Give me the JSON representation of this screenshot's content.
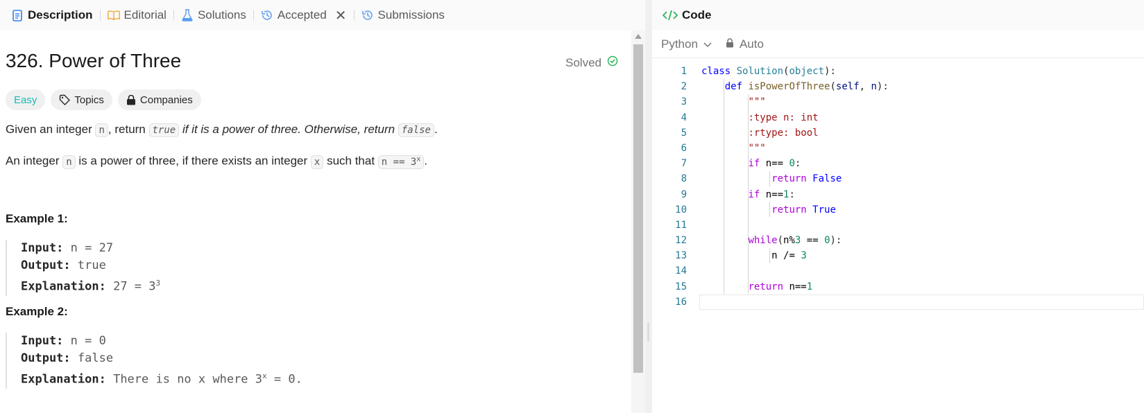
{
  "tabs": [
    {
      "label": "Description",
      "icon": "description-icon",
      "active": true
    },
    {
      "label": "Editorial",
      "icon": "book-icon"
    },
    {
      "label": "Solutions",
      "icon": "flask-icon"
    },
    {
      "label": "Accepted",
      "icon": "history-icon",
      "closable": true
    },
    {
      "label": "Submissions",
      "icon": "history-icon"
    }
  ],
  "problem": {
    "title": "326. Power of Three",
    "status": "Solved",
    "difficulty": "Easy",
    "topics_label": "Topics",
    "companies_label": "Companies",
    "para1": {
      "t1": "Given an integer ",
      "c1": "n",
      "t2": ", return ",
      "c2": "true",
      "t3": " if it is a power of three. Otherwise, return ",
      "c3": "false",
      "t4": "."
    },
    "para2": {
      "t1": "An integer ",
      "c1": "n",
      "t2": " is a power of three, if there exists an integer ",
      "c2": "x",
      "t3": " such that ",
      "c3": "n == 3",
      "c3sup": "x",
      "t4": "."
    },
    "examples": [
      {
        "heading": "Example 1:",
        "input_label": "Input:",
        "input": "n = 27",
        "output_label": "Output:",
        "output": "true",
        "explanation_label": "Explanation:",
        "explanation": "27 = 3",
        "explanation_sup": "3"
      },
      {
        "heading": "Example 2:",
        "input_label": "Input:",
        "input": "n = 0",
        "output_label": "Output:",
        "output": "false",
        "explanation_label": "Explanation:",
        "explanation": "There is no x where 3",
        "explanation_sup": "x",
        "explanation_tail": " = 0."
      }
    ]
  },
  "code_panel": {
    "title": "Code",
    "language": "Python",
    "mode": "Auto",
    "line_numbers": [
      "1",
      "2",
      "3",
      "4",
      "5",
      "6",
      "7",
      "8",
      "9",
      "10",
      "11",
      "12",
      "13",
      "14",
      "15",
      "16"
    ]
  },
  "colors": {
    "accent_easy": "#1cb8b8",
    "solved_check": "#2db55d",
    "code_icon": "#2db55d"
  }
}
